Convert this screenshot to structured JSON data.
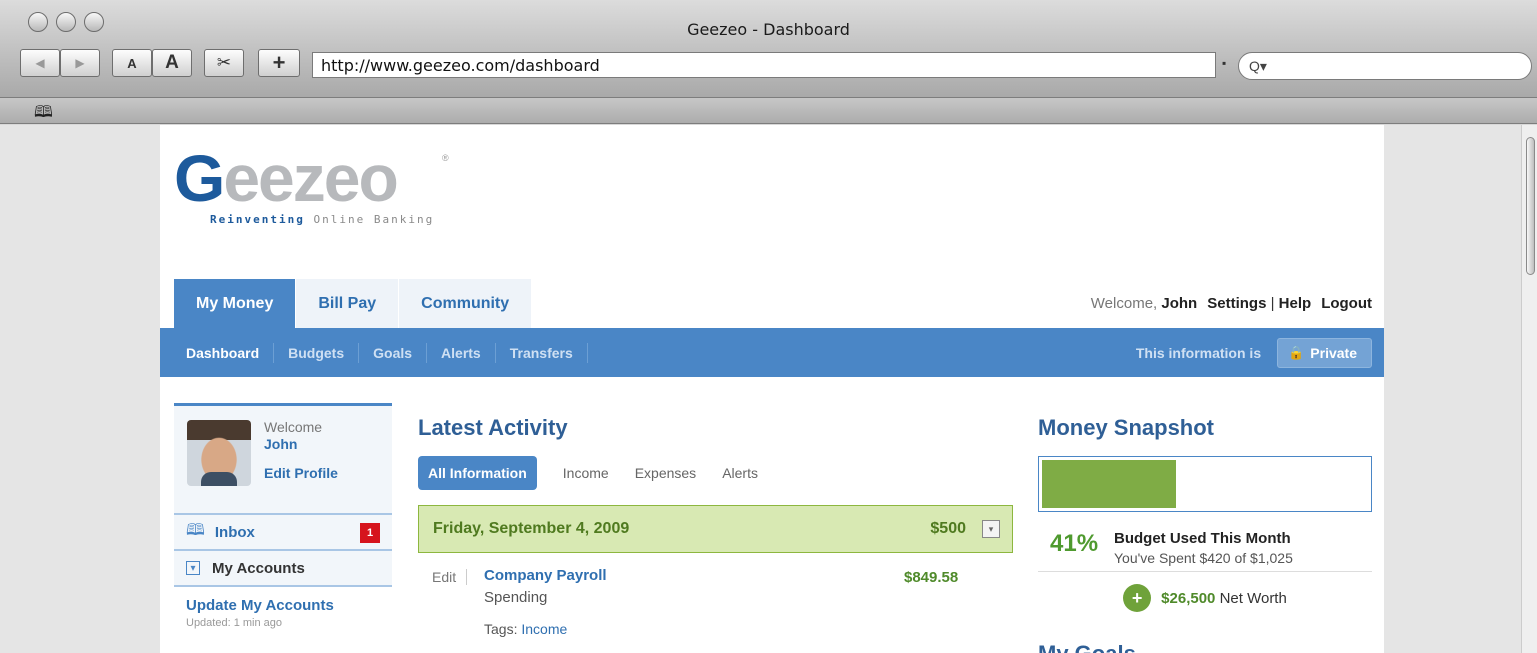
{
  "window": {
    "title": "Geezeo - Dashboard"
  },
  "toolbar": {
    "back_icon": "◀",
    "forward_icon": "▶",
    "text_smaller": "A",
    "text_larger": "A",
    "snip_icon": "✂",
    "add_icon": "+",
    "url": "http://www.geezeo.com/dashboard",
    "search_icon": "Q▾"
  },
  "bookmarks": {
    "icon": "🕮"
  },
  "logo": {
    "g": "G",
    "rest": "eezeo",
    "reg": "®",
    "tag_bold": "Reinventing",
    "tag_rest": " Online Banking"
  },
  "tabs": [
    {
      "label": "My Money",
      "active": true
    },
    {
      "label": "Bill Pay"
    },
    {
      "label": "Community"
    }
  ],
  "user_menu": {
    "welcome": "Welcome,",
    "name": "John",
    "settings": "Settings",
    "sep": "|",
    "help": "Help",
    "logout": "Logout"
  },
  "subnav": {
    "items": [
      "Dashboard",
      "Budgets",
      "Goals",
      "Alerts",
      "Transfers"
    ],
    "privacy_label": "This information is",
    "private_button": "Private",
    "lock_icon": "🔒"
  },
  "sidebar": {
    "welcome": "Welcome",
    "name": "John",
    "edit_profile": "Edit Profile",
    "inbox_icon": "🕮",
    "inbox": "Inbox",
    "inbox_count": "1",
    "collapse_icon": "▾",
    "my_accounts": "My Accounts",
    "update_accounts": "Update My Accounts",
    "updated": "Updated: 1 min ago"
  },
  "activity": {
    "title": "Latest Activity",
    "filters": [
      "All Information",
      "Income",
      "Expenses",
      "Alerts"
    ],
    "day": {
      "date": "Friday, September 4, 2009",
      "amount": "$500",
      "dropdown_icon": "▾"
    },
    "transactions": [
      {
        "edit": "Edit",
        "payee": "Company Payroll",
        "category": "Spending",
        "amount": "$849.58",
        "tags_label": "Tags:",
        "tag": "Income"
      }
    ]
  },
  "snapshot": {
    "title": "Money Snapshot",
    "budget_fraction": 0.41,
    "percent": "41%",
    "budget_title": "Budget Used This Month",
    "budget_sub": "You've Spent $420 of $1,025",
    "plus_icon": "+",
    "net_worth_value": "$26,500",
    "net_worth_label": "Net Worth",
    "goals_title": "My Goals"
  },
  "colors": {
    "brand_blue": "#4a86c6",
    "brand_green": "#7fac45",
    "alert_red": "#d6141d"
  }
}
